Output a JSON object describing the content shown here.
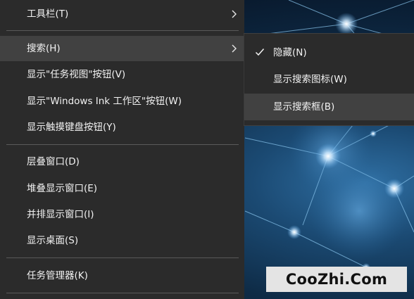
{
  "context_menu": {
    "items": [
      {
        "label": "工具栏(T)",
        "has_submenu": true
      },
      {
        "label": "搜索(H)",
        "has_submenu": true,
        "highlighted": true
      },
      {
        "label": "显示\"任务视图\"按钮(V)"
      },
      {
        "label": "显示\"Windows Ink 工作区\"按钮(W)"
      },
      {
        "label": "显示触摸键盘按钮(Y)"
      },
      {
        "label": "层叠窗口(D)"
      },
      {
        "label": "堆叠显示窗口(E)"
      },
      {
        "label": "并排显示窗口(I)"
      },
      {
        "label": "显示桌面(S)"
      },
      {
        "label": "任务管理器(K)"
      }
    ]
  },
  "search_submenu": {
    "items": [
      {
        "label": "隐藏(N)",
        "checked": true
      },
      {
        "label": "显示搜索图标(W)",
        "checked": false
      },
      {
        "label": "显示搜索框(B)",
        "checked": false,
        "highlighted": true
      }
    ]
  },
  "watermark": {
    "text": "CooZhi.Com"
  },
  "colors": {
    "menu_background": "#2b2b2b",
    "menu_highlight": "#414141",
    "menu_text": "#f2f2f2",
    "separator": "#5a5a5a",
    "watermark_background": "#e4e4e4",
    "wallpaper_dark": "#08172a",
    "wallpaper_glow": "#2f6fa3"
  }
}
